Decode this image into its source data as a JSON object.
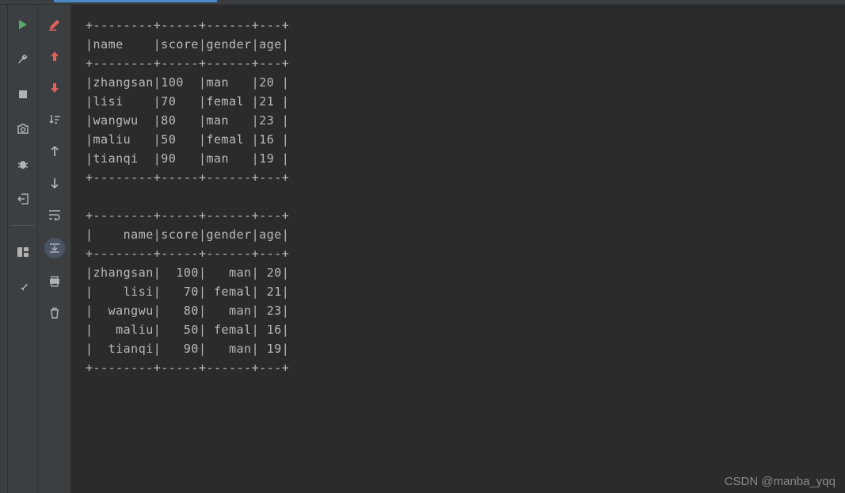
{
  "table1": {
    "border": "+--------+-----+------+---+",
    "header": "|name    |score|gender|age|",
    "rows": [
      "|zhangsan|100  |man   |20 |",
      "|lisi    |70   |femal |21 |",
      "|wangwu  |80   |man   |23 |",
      "|maliu   |50   |femal |16 |",
      "|tianqi  |90   |man   |19 |"
    ]
  },
  "table2": {
    "border": "+--------+-----+------+---+",
    "header": "|    name|score|gender|age|",
    "rows": [
      "|zhangsan|  100|   man| 20|",
      "|    lisi|   70| femal| 21|",
      "|  wangwu|   80|   man| 23|",
      "|   maliu|   50| femal| 16|",
      "|  tianqi|   90|   man| 19|"
    ]
  },
  "watermark": "CSDN @manba_yqq"
}
